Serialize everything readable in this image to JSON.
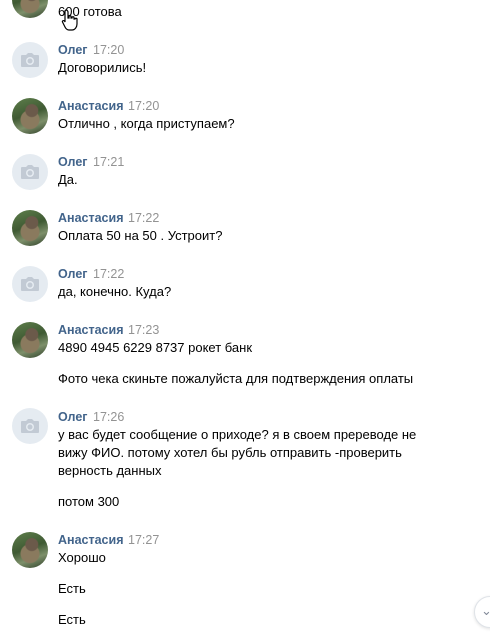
{
  "messages": [
    {
      "text": "600 готова"
    },
    {
      "name": "Олег",
      "time": "17:20",
      "text": "Договорились!"
    },
    {
      "name": "Анастасия",
      "time": "17:20",
      "text": "Отлично , когда приступаем?"
    },
    {
      "name": "Олег",
      "time": "17:21",
      "text": "Да."
    },
    {
      "name": "Анастасия",
      "time": "17:22",
      "text": "Оплата 50 на 50 . Устроит?"
    },
    {
      "name": "Олег",
      "time": "17:22",
      "text": "да, конечно. Куда?"
    },
    {
      "name": "Анастасия",
      "time": "17:23",
      "lines": [
        "4890 4945 6229 8737 рокет банк",
        "Фото чека скиньте пожалуйста для подтверждения оплаты"
      ]
    },
    {
      "name": "Олег",
      "time": "17:26",
      "lines": [
        "у вас будет сообщение о приходе? я в своем пререводе не",
        "вижу ФИО. потому хотел бы рубль отправить -проверить",
        "верность данных",
        "потом 300"
      ]
    },
    {
      "name": "Анастасия",
      "time": "17:27",
      "lines": [
        "Хорошо",
        "Есть",
        "Есть"
      ]
    }
  ],
  "icons": {
    "camera": "camera-icon",
    "scroll": "chevron-down-icon",
    "cursor": "hand-cursor-icon"
  },
  "colors": {
    "name": "#42648b",
    "time": "#939393",
    "avatar_placeholder": "#e5ebf1"
  }
}
